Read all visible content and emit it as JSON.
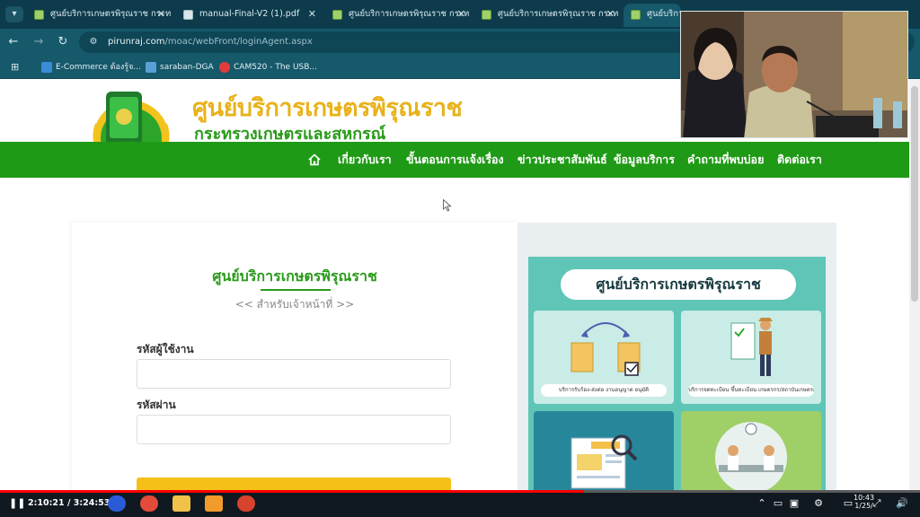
{
  "browser": {
    "tabs": [
      {
        "title": "ศูนย์บริการเกษตรพิรุณราช กระท"
      },
      {
        "title": "manual-Final-V2 (1).pdf"
      },
      {
        "title": "ศูนย์บริการเกษตรพิรุณราช กระท"
      },
      {
        "title": "ศูนย์บริการเกษตรพิรุณราช กระท"
      },
      {
        "title": "ศูนย์บริการเกษตรพิรุณราช"
      }
    ],
    "url_host": "pirunraj.com",
    "url_path": "/moac/webFront/loginAgent.aspx",
    "bookmarks": [
      {
        "label": "E-Commerce ต้องรู้จ..."
      },
      {
        "label": "saraban-DGA"
      },
      {
        "label": "CAM520 - The USB..."
      }
    ]
  },
  "site": {
    "title": "ศูนย์บริการเกษตรพิรุณราช",
    "subtitle": "กระทรวงเกษตรและสหกรณ์",
    "menu": [
      {
        "label": "เกี่ยวกับเรา"
      },
      {
        "label": "ขั้นตอนการแจ้งเรื่อง"
      },
      {
        "label": "ข่าวประชาสัมพันธ์"
      },
      {
        "label": "ข้อมูลบริการ"
      },
      {
        "label": "คำถามที่พบบ่อย"
      },
      {
        "label": "ติดต่อเรา"
      }
    ]
  },
  "login": {
    "title": "ศูนย์บริการเกษตรพิรุณราช",
    "subtitle": "<< สำหรับเจ้าหน้าที่ >>",
    "username_label": "รหัสผู้ใช้งาน",
    "password_label": "รหัสผ่าน",
    "username_value": "",
    "password_value": ""
  },
  "info_panel": {
    "title": "ศูนย์บริการเกษตรพิรุณราช",
    "caption_1": "บริการรับร้อง-ส่งต่อ งานอนุญาต อนุมัติ",
    "caption_2": "บริการจดทะเบียน ขึ้นทะเบียน เกษตรกร/สถาบันเกษตรกร"
  },
  "player": {
    "current_time": "2:10:21",
    "duration": "3:24:53",
    "progress_fraction": 0.635
  },
  "taskbar": {
    "clock_time": "10:43",
    "clock_date": "1/25/"
  },
  "colors": {
    "site_green": "#1f9a16",
    "site_gold": "#e8b21a",
    "browser_chrome": "#15596b",
    "button_yellow": "#f5c018"
  }
}
